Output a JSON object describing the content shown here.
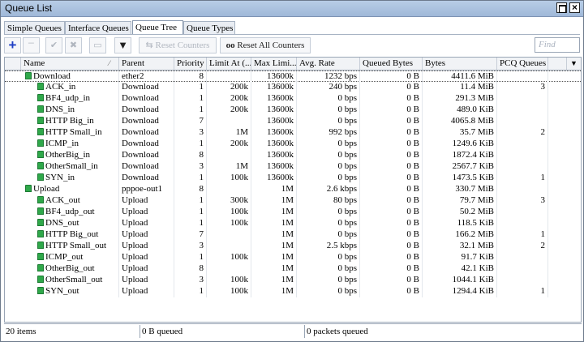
{
  "window": {
    "title": "Queue List"
  },
  "tabs": [
    "Simple Queues",
    "Interface Queues",
    "Queue Tree",
    "Queue Types"
  ],
  "toolbar": {
    "reset_counters": "Reset Counters",
    "reset_all_counters": "Reset All Counters",
    "find_placeholder": "Find"
  },
  "columns": [
    "Name",
    "Parent",
    "Priority",
    "Limit At (...",
    "Max Limi...",
    "Avg. Rate",
    "Queued Bytes",
    "Bytes",
    "PCQ Queues"
  ],
  "rows": [
    {
      "name": "Download",
      "parent": "ether2",
      "priority": "8",
      "limit_at": "",
      "max_limit": "13600k",
      "avg_rate": "1232 bps",
      "queued": "0 B",
      "bytes": "4411.6 MiB",
      "pcq": ""
    },
    {
      "name": "ACK_in",
      "parent": "Download",
      "priority": "1",
      "limit_at": "200k",
      "max_limit": "13600k",
      "avg_rate": "240 bps",
      "queued": "0 B",
      "bytes": "11.4 MiB",
      "pcq": "3"
    },
    {
      "name": "BF4_udp_in",
      "parent": "Download",
      "priority": "1",
      "limit_at": "200k",
      "max_limit": "13600k",
      "avg_rate": "0 bps",
      "queued": "0 B",
      "bytes": "291.3 MiB",
      "pcq": ""
    },
    {
      "name": "DNS_in",
      "parent": "Download",
      "priority": "1",
      "limit_at": "200k",
      "max_limit": "13600k",
      "avg_rate": "0 bps",
      "queued": "0 B",
      "bytes": "489.0 KiB",
      "pcq": ""
    },
    {
      "name": "HTTP Big_in",
      "parent": "Download",
      "priority": "7",
      "limit_at": "",
      "max_limit": "13600k",
      "avg_rate": "0 bps",
      "queued": "0 B",
      "bytes": "4065.8 MiB",
      "pcq": ""
    },
    {
      "name": "HTTP Small_in",
      "parent": "Download",
      "priority": "3",
      "limit_at": "1M",
      "max_limit": "13600k",
      "avg_rate": "992 bps",
      "queued": "0 B",
      "bytes": "35.7 MiB",
      "pcq": "2"
    },
    {
      "name": "ICMP_in",
      "parent": "Download",
      "priority": "1",
      "limit_at": "200k",
      "max_limit": "13600k",
      "avg_rate": "0 bps",
      "queued": "0 B",
      "bytes": "1249.6 KiB",
      "pcq": ""
    },
    {
      "name": "OtherBig_in",
      "parent": "Download",
      "priority": "8",
      "limit_at": "",
      "max_limit": "13600k",
      "avg_rate": "0 bps",
      "queued": "0 B",
      "bytes": "1872.4 KiB",
      "pcq": ""
    },
    {
      "name": "OtherSmall_in",
      "parent": "Download",
      "priority": "3",
      "limit_at": "1M",
      "max_limit": "13600k",
      "avg_rate": "0 bps",
      "queued": "0 B",
      "bytes": "2567.7 KiB",
      "pcq": ""
    },
    {
      "name": "SYN_in",
      "parent": "Download",
      "priority": "1",
      "limit_at": "100k",
      "max_limit": "13600k",
      "avg_rate": "0 bps",
      "queued": "0 B",
      "bytes": "1473.5 KiB",
      "pcq": "1"
    },
    {
      "name": "Upload",
      "parent": "pppoe-out1",
      "priority": "8",
      "limit_at": "",
      "max_limit": "1M",
      "avg_rate": "2.6 kbps",
      "queued": "0 B",
      "bytes": "330.7 MiB",
      "pcq": ""
    },
    {
      "name": "ACK_out",
      "parent": "Upload",
      "priority": "1",
      "limit_at": "300k",
      "max_limit": "1M",
      "avg_rate": "80 bps",
      "queued": "0 B",
      "bytes": "79.7 MiB",
      "pcq": "3"
    },
    {
      "name": "BF4_udp_out",
      "parent": "Upload",
      "priority": "1",
      "limit_at": "100k",
      "max_limit": "1M",
      "avg_rate": "0 bps",
      "queued": "0 B",
      "bytes": "50.2 MiB",
      "pcq": ""
    },
    {
      "name": "DNS_out",
      "parent": "Upload",
      "priority": "1",
      "limit_at": "100k",
      "max_limit": "1M",
      "avg_rate": "0 bps",
      "queued": "0 B",
      "bytes": "118.5 KiB",
      "pcq": ""
    },
    {
      "name": "HTTP Big_out",
      "parent": "Upload",
      "priority": "7",
      "limit_at": "",
      "max_limit": "1M",
      "avg_rate": "0 bps",
      "queued": "0 B",
      "bytes": "166.2 MiB",
      "pcq": "1"
    },
    {
      "name": "HTTP Small_out",
      "parent": "Upload",
      "priority": "3",
      "limit_at": "",
      "max_limit": "1M",
      "avg_rate": "2.5 kbps",
      "queued": "0 B",
      "bytes": "32.1 MiB",
      "pcq": "2"
    },
    {
      "name": "ICMP_out",
      "parent": "Upload",
      "priority": "1",
      "limit_at": "100k",
      "max_limit": "1M",
      "avg_rate": "0 bps",
      "queued": "0 B",
      "bytes": "91.7 KiB",
      "pcq": ""
    },
    {
      "name": "OtherBig_out",
      "parent": "Upload",
      "priority": "8",
      "limit_at": "",
      "max_limit": "1M",
      "avg_rate": "0 bps",
      "queued": "0 B",
      "bytes": "42.1 KiB",
      "pcq": ""
    },
    {
      "name": "OtherSmall_out",
      "parent": "Upload",
      "priority": "3",
      "limit_at": "100k",
      "max_limit": "1M",
      "avg_rate": "0 bps",
      "queued": "0 B",
      "bytes": "1044.1 KiB",
      "pcq": ""
    },
    {
      "name": "SYN_out",
      "parent": "Upload",
      "priority": "1",
      "limit_at": "100k",
      "max_limit": "1M",
      "avg_rate": "0 bps",
      "queued": "0 B",
      "bytes": "1294.4 KiB",
      "pcq": "1"
    }
  ],
  "status": {
    "items": "20 items",
    "queued": "0 B queued",
    "packets": "0 packets queued"
  }
}
